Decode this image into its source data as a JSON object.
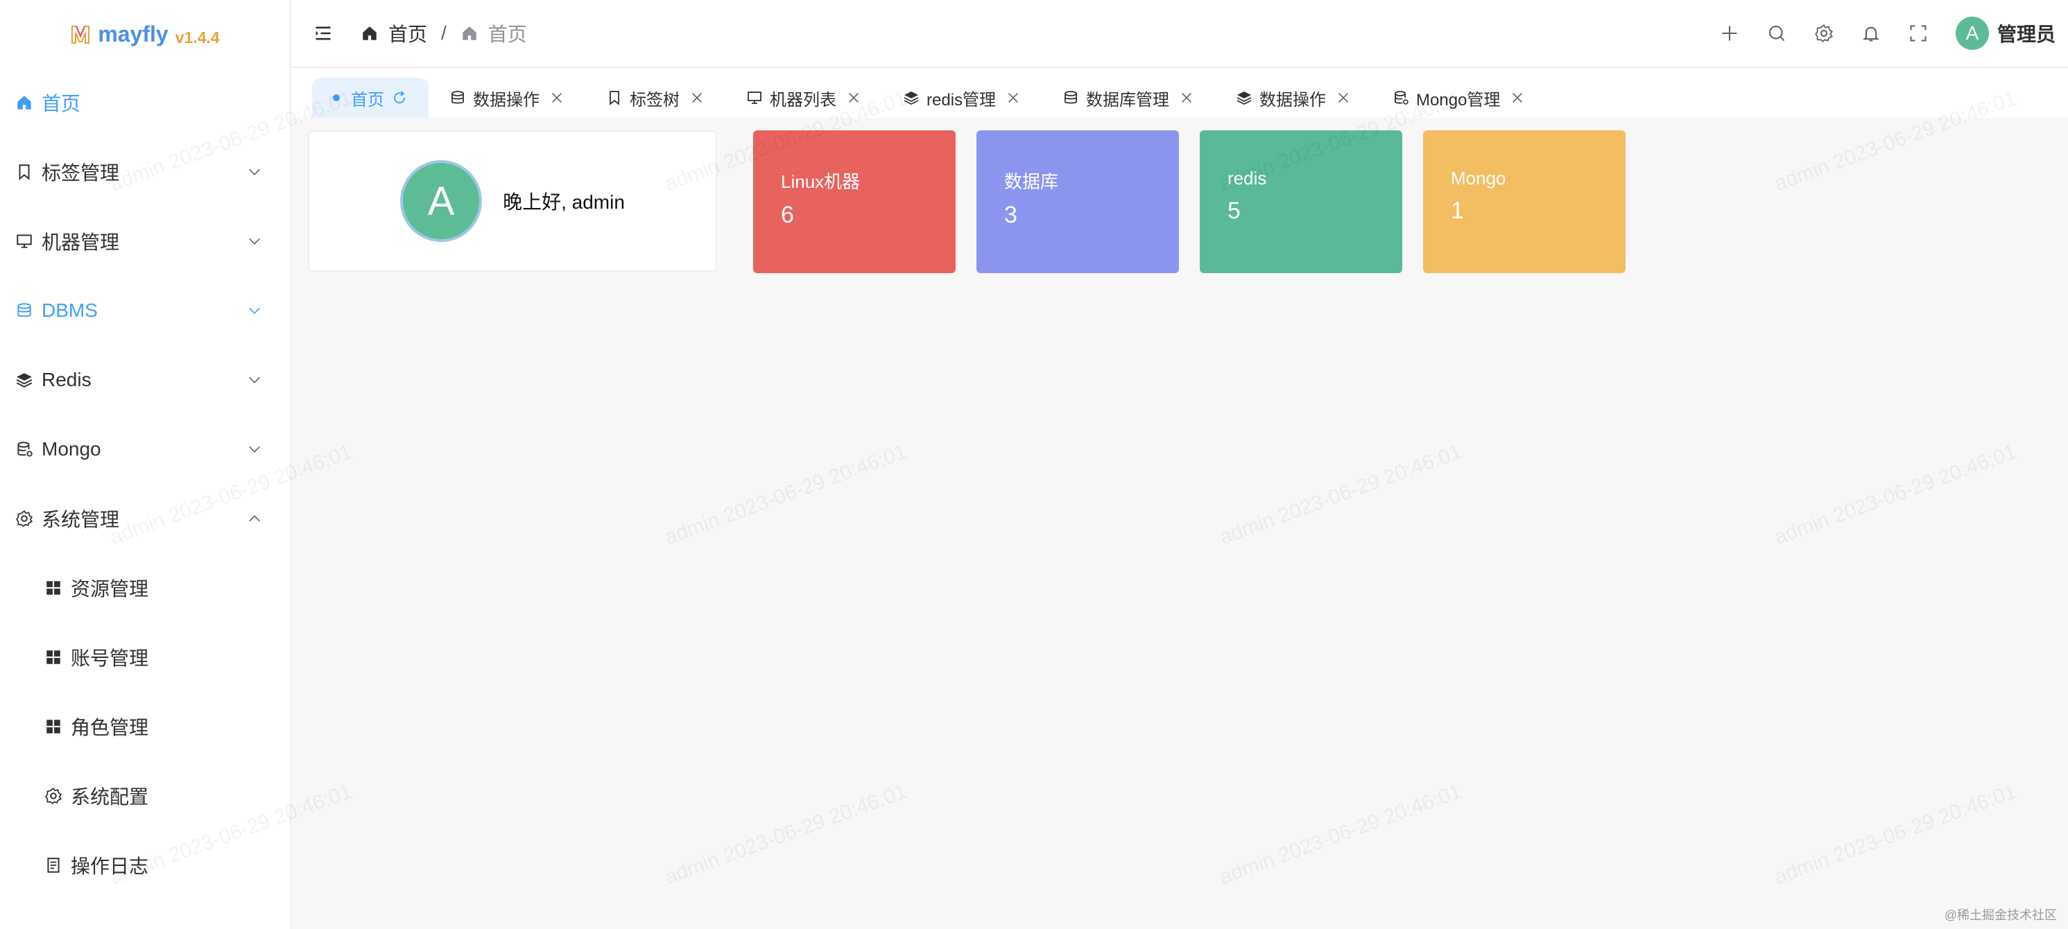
{
  "logo": {
    "name": "mayfly",
    "version": "v1.4.4"
  },
  "sidebar": {
    "items": [
      {
        "label": "首页",
        "icon": "home-icon"
      },
      {
        "label": "标签管理",
        "icon": "bookmark-icon"
      },
      {
        "label": "机器管理",
        "icon": "monitor-icon"
      },
      {
        "label": "DBMS",
        "icon": "database-icon"
      },
      {
        "label": "Redis",
        "icon": "layers-icon"
      },
      {
        "label": "Mongo",
        "icon": "database-setting-icon"
      },
      {
        "label": "系统管理",
        "icon": "gear-icon"
      }
    ],
    "sub_items": [
      {
        "label": "资源管理",
        "icon": "grid-icon"
      },
      {
        "label": "账号管理",
        "icon": "grid-icon"
      },
      {
        "label": "角色管理",
        "icon": "grid-icon"
      },
      {
        "label": "系统配置",
        "icon": "gear-icon"
      },
      {
        "label": "操作日志",
        "icon": "document-icon"
      }
    ]
  },
  "breadcrumb": {
    "home": "首页",
    "separator": "/",
    "current": "首页"
  },
  "user": {
    "avatar": "A",
    "name": "管理员"
  },
  "tags": [
    {
      "label": "首页",
      "icon": "refresh-icon"
    },
    {
      "label": "数据操作",
      "icon": "database-icon"
    },
    {
      "label": "标签树",
      "icon": "bookmark-icon"
    },
    {
      "label": "机器列表",
      "icon": "monitor-icon"
    },
    {
      "label": "redis管理",
      "icon": "layers-icon"
    },
    {
      "label": "数据库管理",
      "icon": "database-icon"
    },
    {
      "label": "数据操作",
      "icon": "layers-icon"
    },
    {
      "label": "Mongo管理",
      "icon": "database-setting-icon"
    }
  ],
  "welcome": {
    "avatar": "A",
    "greeting": "晚上好, admin"
  },
  "stats": [
    {
      "label": "Linux机器",
      "value": "6",
      "color": "#e9635e"
    },
    {
      "label": "数据库",
      "value": "3",
      "color": "#8c95ee"
    },
    {
      "label": "redis",
      "value": "5",
      "color": "#5ab99b"
    },
    {
      "label": "Mongo",
      "value": "1",
      "color": "#f3bd62"
    }
  ],
  "watermark": "admin 2023-06-29 20:46:01",
  "footer_note": "@稀土掘金技术社区"
}
